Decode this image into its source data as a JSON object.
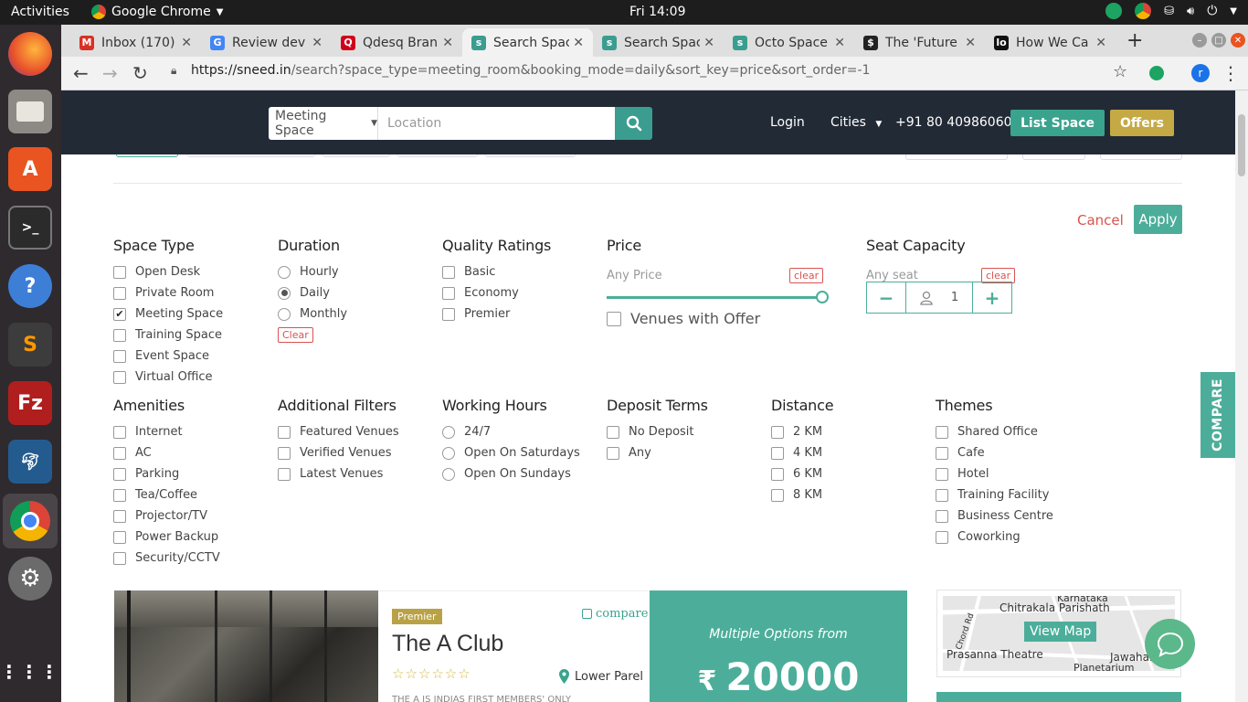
{
  "os": {
    "activities": "Activities",
    "app_name": "Google Chrome",
    "clock": "Fri 14:09"
  },
  "browser": {
    "tabs": [
      {
        "label": "Inbox (170)",
        "fav_color": "#d93025",
        "fav_glyph": "M"
      },
      {
        "label": "Review dev",
        "fav_color": "#4285f4",
        "fav_glyph": "G"
      },
      {
        "label": "Qdesq Bran",
        "fav_color": "#d0021b",
        "fav_glyph": "Q"
      },
      {
        "label": "Search Spac",
        "fav_color": "#3a9d8f",
        "fav_glyph": "s"
      },
      {
        "label": "Search Spac",
        "fav_color": "#3a9d8f",
        "fav_glyph": "s"
      },
      {
        "label": "Octo Space",
        "fav_color": "#3a9d8f",
        "fav_glyph": "s"
      },
      {
        "label": "The 'Future",
        "fav_color": "#222222",
        "fav_glyph": "$"
      },
      {
        "label": "How We Ca",
        "fav_color": "#111111",
        "fav_glyph": "lo"
      }
    ],
    "active_tab": 3,
    "url_host": "https://sneed.in",
    "url_path": "/search?space_type=meeting_room&booking_mode=daily&sort_key=price&sort_order=-1",
    "profile_initial": "r"
  },
  "header": {
    "search_type": "Meeting Space",
    "location_placeholder": "Location",
    "login": "Login",
    "cities": "Cities",
    "phone": "+91 80 40986060",
    "list_space": "List Space",
    "offers": "Offers"
  },
  "filters": {
    "cancel": "Cancel",
    "apply": "Apply",
    "space_type": {
      "title": "Space Type",
      "options": [
        {
          "label": "Open Desk",
          "checked": false
        },
        {
          "label": "Private Room",
          "checked": false
        },
        {
          "label": "Meeting Space",
          "checked": true
        },
        {
          "label": "Training Space",
          "checked": false
        },
        {
          "label": "Event Space",
          "checked": false
        },
        {
          "label": "Virtual Office",
          "checked": false
        }
      ]
    },
    "duration": {
      "title": "Duration",
      "options": [
        {
          "label": "Hourly",
          "selected": false
        },
        {
          "label": "Daily",
          "selected": true
        },
        {
          "label": "Monthly",
          "selected": false
        }
      ],
      "clear": "Clear"
    },
    "quality": {
      "title": "Quality Ratings",
      "options": [
        "Basic",
        "Economy",
        "Premier"
      ]
    },
    "price": {
      "title": "Price",
      "sub": "Any Price",
      "clear": "clear",
      "slider_fraction": 1.0,
      "offer_label": "Venues with Offer"
    },
    "seat": {
      "title": "Seat Capacity",
      "sub": "Any seat",
      "clear": "clear",
      "value": "1",
      "minus": "−",
      "plus": "+"
    },
    "amenities": {
      "title": "Amenities",
      "options": [
        "Internet",
        "AC",
        "Parking",
        "Tea/Coffee",
        "Projector/TV",
        "Power Backup",
        "Security/CCTV"
      ]
    },
    "additional": {
      "title": "Additional Filters",
      "options": [
        "Featured Venues",
        "Verified Venues",
        "Latest Venues"
      ]
    },
    "hours": {
      "title": "Working Hours",
      "options": [
        "24/7",
        "Open On Saturdays",
        "Open On Sundays"
      ]
    },
    "deposit": {
      "title": "Deposit Terms",
      "options": [
        "No Deposit",
        "Any"
      ]
    },
    "distance": {
      "title": "Distance",
      "options": [
        "2 KM",
        "4 KM",
        "6 KM",
        "8 KM"
      ]
    },
    "themes": {
      "title": "Themes",
      "options": [
        "Shared Office",
        "Cafe",
        "Hotel",
        "Training Facility",
        "Business Centre",
        "Coworking"
      ]
    }
  },
  "compare_tab": "COMPARE",
  "listing": {
    "badge": "Premier",
    "compare": "compare",
    "name": "The A Club",
    "stars": "☆☆☆☆☆☆",
    "locality": "Lower Parel",
    "description": "THE A IS INDIAS FIRST MEMBERS' ONLY",
    "price_from": "Multiple Options from",
    "currency": "₹",
    "price": "20000"
  },
  "map": {
    "label_top": "Karnataka",
    "label_parishath": "Chitrakala Parishath",
    "label_theatre": "Prasanna Theatre",
    "label_jawaharlal": "Jawaharlal",
    "label_planetarium": "Planetarium Bangalo",
    "label_road": "Chord Rd",
    "view_map": "View Map"
  }
}
